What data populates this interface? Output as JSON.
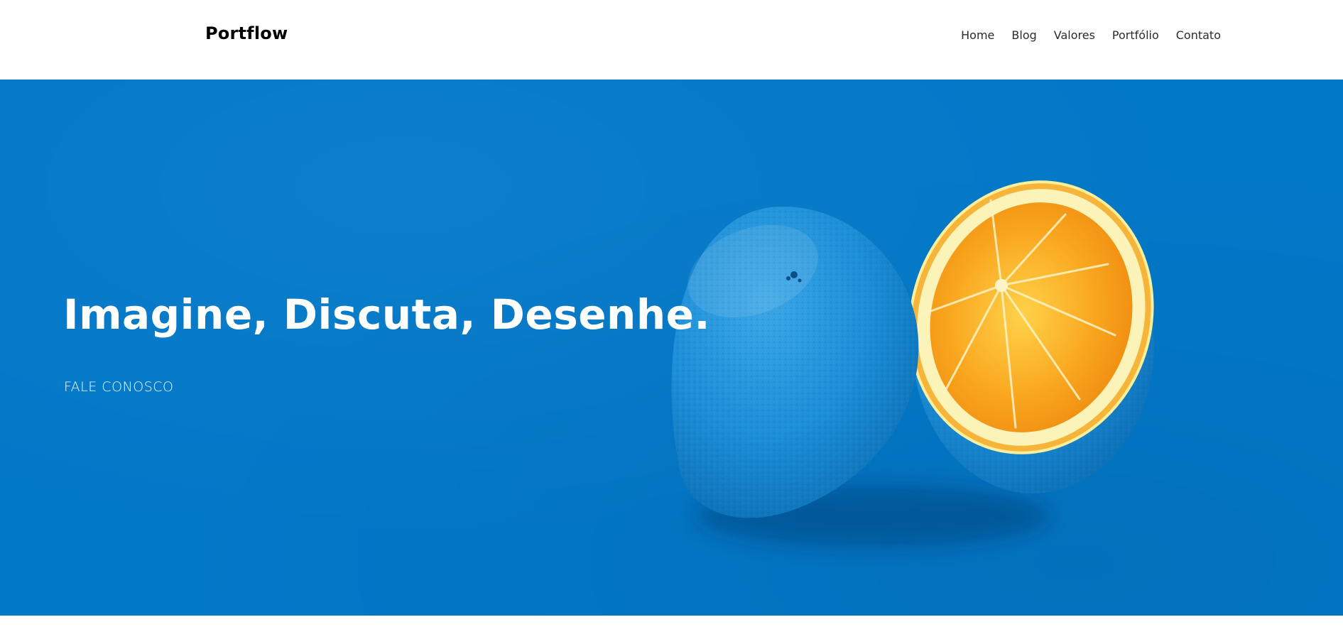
{
  "brand": {
    "name": "Portflow"
  },
  "nav": {
    "items": [
      {
        "label": "Home"
      },
      {
        "label": "Blog"
      },
      {
        "label": "Valores"
      },
      {
        "label": "Portfólio"
      },
      {
        "label": "Contato"
      }
    ]
  },
  "hero": {
    "title": "Imagine, Discuta, Desenhe.",
    "cta_label": "FALE CONOSCO",
    "background_color": "#0278c8",
    "image": "painted-orange-halves"
  },
  "colors": {
    "text_dark": "#000000",
    "nav_text": "#2b2b2b",
    "hero_bg": "#0278c8",
    "orange_flesh": "#f7a21a",
    "orange_rind": "#fbe57a"
  }
}
